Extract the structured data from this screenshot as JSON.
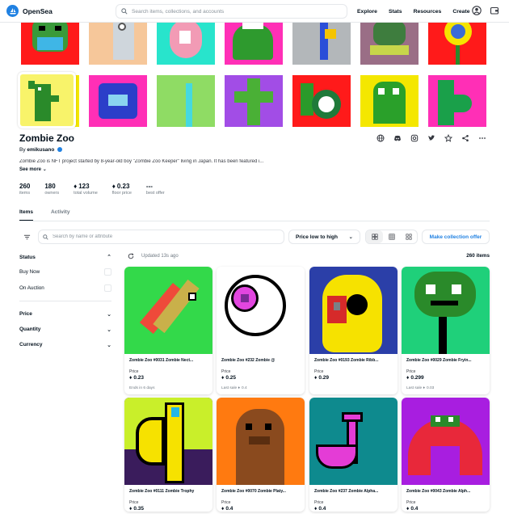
{
  "header": {
    "logo_text": "OpenSea",
    "search_placeholder": "Search items, collections, and accounts",
    "nav": [
      "Explore",
      "Stats",
      "Resources",
      "Create"
    ],
    "icons": [
      "account-icon",
      "wallet-icon"
    ]
  },
  "collection": {
    "title": "Zombie Zoo",
    "by_prefix": "By",
    "creator": "emikusano",
    "description": "Zombie Zoo is NFT project started by 8-year-old boy \"Zombie Zoo Keeper\" living in Japan. It has been featured i...",
    "see_more": "See more",
    "social_icons": [
      "website-icon",
      "discord-icon",
      "instagram-icon",
      "twitter-icon",
      "star-icon",
      "share-icon",
      "more-icon"
    ],
    "stats": [
      {
        "value": "260",
        "label": "items"
      },
      {
        "value": "180",
        "label": "owners"
      },
      {
        "value": "123",
        "label": "total volume",
        "eth": true
      },
      {
        "value": "0.23",
        "label": "floor price",
        "eth": true
      },
      {
        "value": "---",
        "label": "best offer"
      }
    ]
  },
  "tabs": [
    {
      "label": "Items",
      "active": true
    },
    {
      "label": "Activity",
      "active": false
    }
  ],
  "toolbar": {
    "search_placeholder": "Search by name or attribute",
    "sort_label": "Price low to high",
    "offer_button": "Make collection offer"
  },
  "sidebar": {
    "status_label": "Status",
    "status_options": [
      "Buy Now",
      "On Auction"
    ],
    "sections": [
      "Price",
      "Quantity",
      "Currency"
    ]
  },
  "results": {
    "updated": "Updated 13s ago",
    "count": "260 items"
  },
  "items": [
    {
      "name": "Zombie Zoo #0031 Zombie Nect...",
      "price_label": "Price",
      "price": "0.23",
      "footer": "Ends in 6 days"
    },
    {
      "name": "Zombie Zoo #232 Zombie @",
      "price_label": "Price",
      "price": "0.25",
      "footer": "Last sale",
      "last": "0.4"
    },
    {
      "name": "Zombie Zoo #0193 Zombie Ribb...",
      "price_label": "Price",
      "price": "0.29",
      "footer": ""
    },
    {
      "name": "Zombie Zoo #0029 Zombie Fryin...",
      "price_label": "Price",
      "price": "0.299",
      "footer": "Last sale",
      "last": "0.03"
    },
    {
      "name": "Zombie Zoo #0111 Zombie Trophy",
      "price_label": "Price",
      "price": "0.35",
      "footer": ""
    },
    {
      "name": "Zombie Zoo #0070 Zombie Platy...",
      "price_label": "Price",
      "price": "0.4",
      "footer": ""
    },
    {
      "name": "Zombie Zoo #237 Zombie Alpha...",
      "price_label": "Price",
      "price": "0.4",
      "footer": ""
    },
    {
      "name": "Zombie Zoo #0043 Zombie Alph...",
      "price_label": "Price",
      "price": "0.4",
      "footer": ""
    }
  ],
  "colors": {
    "accent": "#2081e2",
    "text": "#04111d",
    "muted": "#707a83",
    "border": "#e5e8eb"
  }
}
